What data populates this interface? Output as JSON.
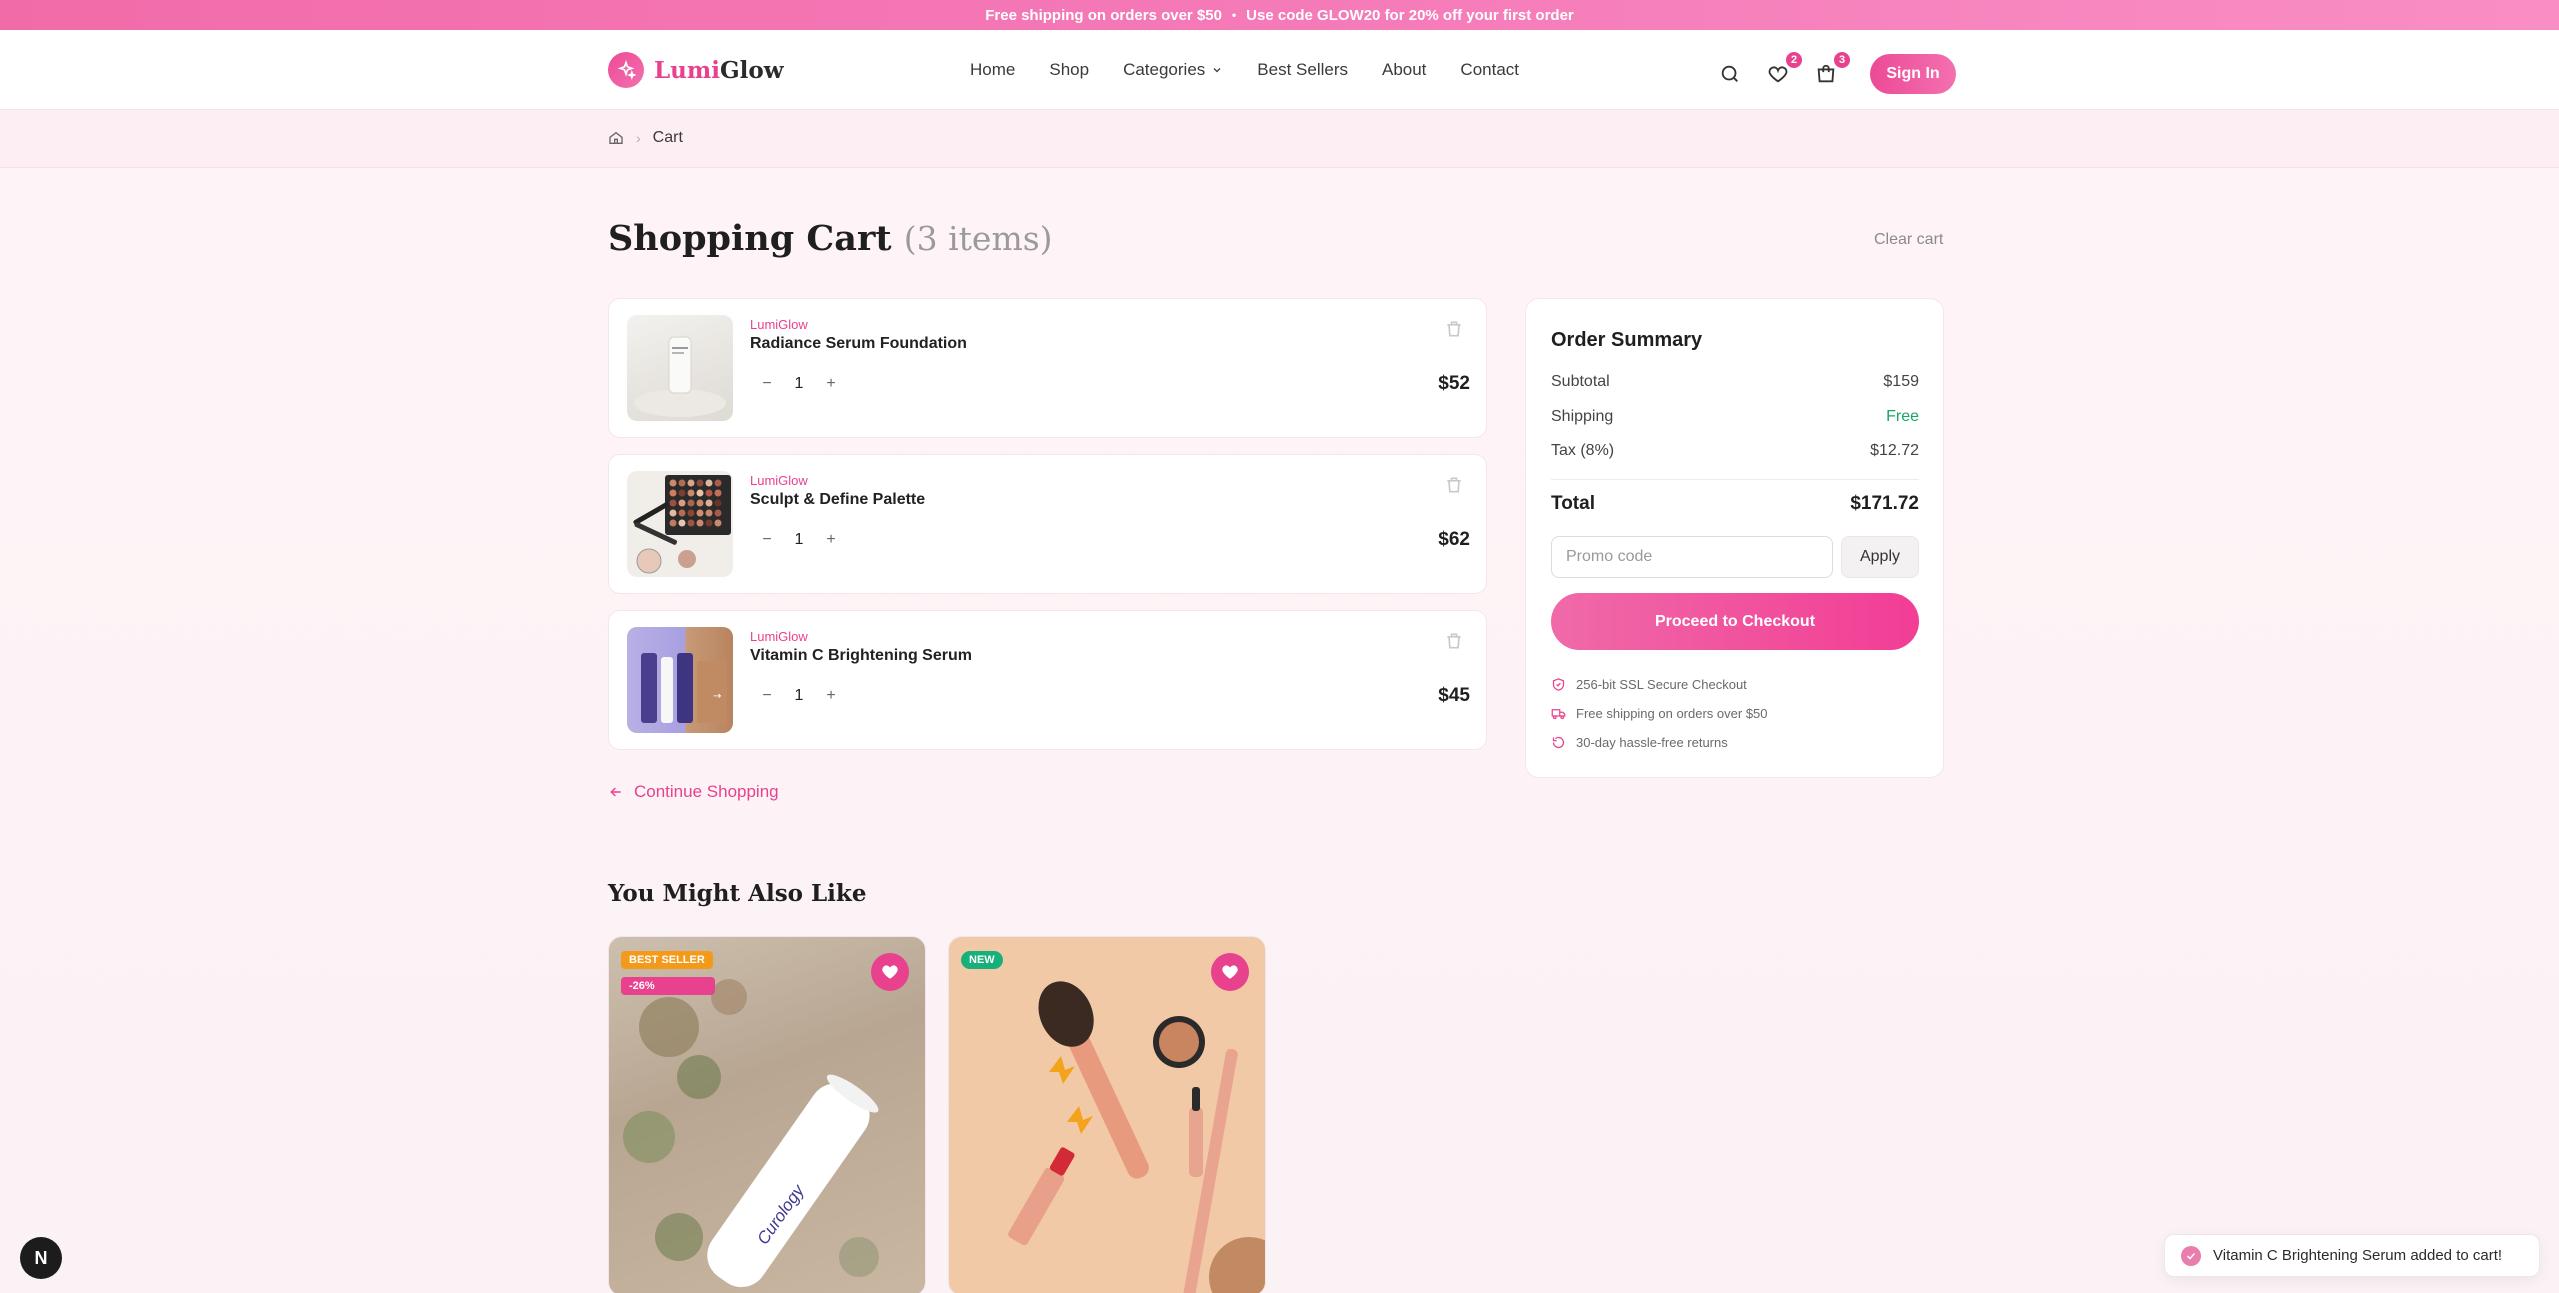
{
  "announcement": {
    "part1": "Free shipping on orders over $50",
    "separator": "•",
    "part2": "Use code",
    "code": "GLOW20",
    "part3": "for 20% off your first order"
  },
  "brand": {
    "name_part1": "Lumi",
    "name_part2": "Glow",
    "color": "#e8418e"
  },
  "nav": {
    "items": [
      "Home",
      "Shop",
      "Categories",
      "Best Sellers",
      "About",
      "Contact"
    ]
  },
  "header": {
    "wishlist_count": "2",
    "cart_count": "3",
    "signin_label": "Sign In"
  },
  "breadcrumb": {
    "current": "Cart"
  },
  "page": {
    "title": "Shopping Cart",
    "count_label": "(3 items)",
    "clear_cart": "Clear cart"
  },
  "cart": {
    "items": [
      {
        "brand": "LumiGlow",
        "name": "Radiance Serum Foundation",
        "qty": "1",
        "price": "$52"
      },
      {
        "brand": "LumiGlow",
        "name": "Sculpt & Define Palette",
        "qty": "1",
        "price": "$62"
      },
      {
        "brand": "LumiGlow",
        "name": "Vitamin C Brightening Serum",
        "qty": "1",
        "price": "$45"
      }
    ],
    "continue_label": "Continue Shopping"
  },
  "summary": {
    "title": "Order Summary",
    "subtotal_label": "Subtotal",
    "subtotal": "$159",
    "shipping_label": "Shipping",
    "shipping": "Free",
    "tax_label": "Tax (8%)",
    "tax": "$12.72",
    "total_label": "Total",
    "total": "$171.72",
    "promo_placeholder": "Promo code",
    "apply_label": "Apply",
    "checkout_label": "Proceed to Checkout",
    "features": [
      "256-bit SSL Secure Checkout",
      "Free shipping on orders over $50",
      "30-day hassle-free returns"
    ]
  },
  "recommendations": {
    "title": "You Might Also Like",
    "cards": [
      {
        "badge1": "BEST SELLER",
        "badge2": "-26%",
        "product_text": "Curology"
      },
      {
        "badge1": "NEW"
      }
    ]
  },
  "toast": {
    "message": "Vitamin C Brightening Serum added to cart!"
  },
  "dev_badge": "N"
}
